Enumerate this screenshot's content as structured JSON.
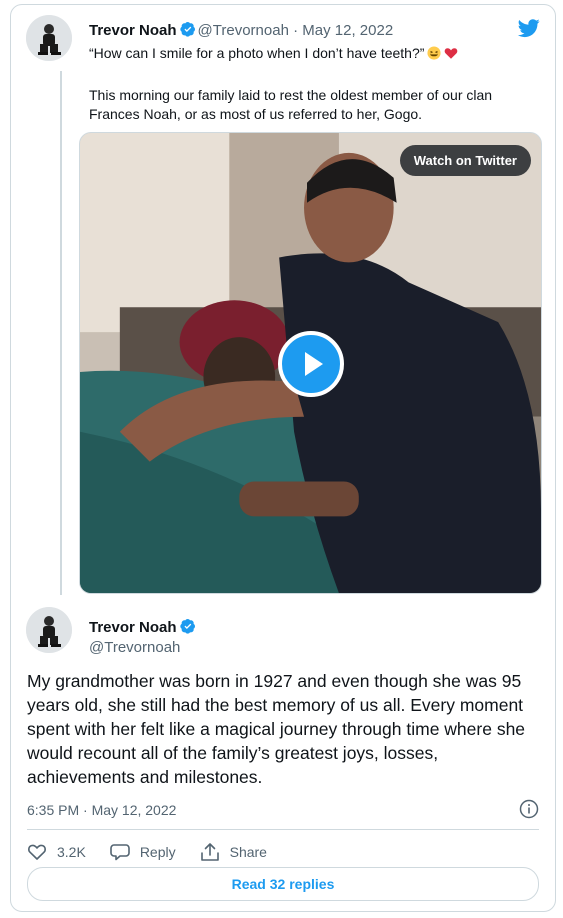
{
  "original_tweet": {
    "author_name": "Trevor Noah",
    "handle": "@Trevornoah",
    "separator": "·",
    "date": "May 12, 2022",
    "reply_text": "“How can I smile for a photo when I don’t have teeth?”",
    "body": "This morning our family laid to rest the oldest member of our clan Frances Noah, or as most of us referred to her, Gogo.",
    "media": {
      "watch_label": "Watch on Twitter"
    }
  },
  "main_tweet": {
    "author_name": "Trevor Noah",
    "handle": "@Trevornoah",
    "text": "My grandmother was born in 1927 and even though she was 95 years old, she still had the best memory of us all. Every moment spent with her felt like a magical journey through time where she would recount all of the family’s greatest joys, losses, achievements and milestones.",
    "timestamp": "6:35 PM · May 12, 2022"
  },
  "actions": {
    "like_count": "3.2K",
    "reply_label": "Reply",
    "share_label": "Share"
  },
  "read_replies_label": "Read 32 replies",
  "icons": {
    "brand": "twitter-bird-icon",
    "verified": "verified-badge-icon",
    "info": "info-icon",
    "like": "heart-icon",
    "reply": "comment-icon",
    "share": "share-upload-icon",
    "play": "play-icon"
  },
  "colors": {
    "accent": "#1d9bf0",
    "text": "#0f1419",
    "muted": "#536471",
    "border": "#cfd9de"
  }
}
